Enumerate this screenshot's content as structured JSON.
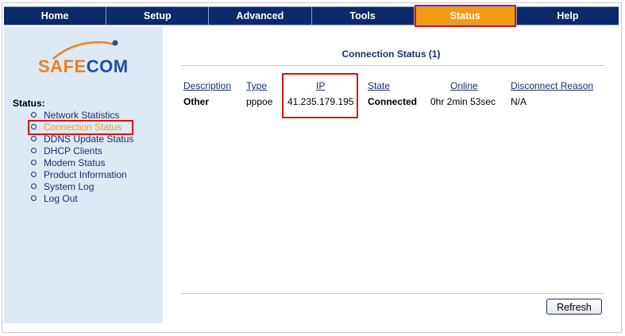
{
  "nav": {
    "tabs": [
      {
        "label": "Home"
      },
      {
        "label": "Setup"
      },
      {
        "label": "Advanced"
      },
      {
        "label": "Tools"
      },
      {
        "label": "Status"
      },
      {
        "label": "Help"
      }
    ],
    "active_tab": "Status",
    "active_color": "#f39c12",
    "bar_color": "#0b2a6b"
  },
  "logo": {
    "part1": "SAFE",
    "part2": "COM"
  },
  "sidebar": {
    "heading": "Status:",
    "items": [
      {
        "label": "Network Statistics"
      },
      {
        "label": "Connection Status"
      },
      {
        "label": "DDNS Update Status"
      },
      {
        "label": "DHCP Clients"
      },
      {
        "label": "Modem Status"
      },
      {
        "label": "Product Information"
      },
      {
        "label": "System Log"
      },
      {
        "label": "Log Out"
      }
    ],
    "current_item": "Connection Status"
  },
  "main": {
    "title": "Connection Status (1)",
    "columns": [
      "Description",
      "Type",
      "IP",
      "State",
      "Online",
      "Disconnect Reason"
    ],
    "rows": [
      [
        "Other",
        "pppoe",
        "41.235.179.195",
        "Connected",
        "0hr 2min 53sec",
        "N/A"
      ]
    ],
    "refresh_label": "Refresh"
  },
  "highlight_color": "#e01010"
}
